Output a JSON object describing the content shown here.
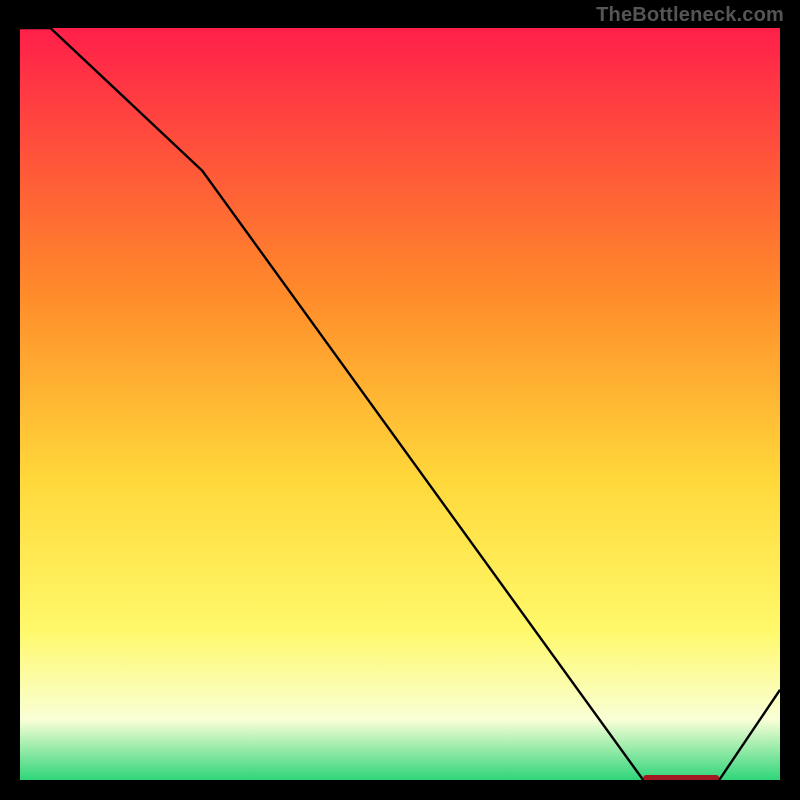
{
  "watermark": "TheBottleneck.com",
  "colors": {
    "top": "#ff1f4a",
    "mid_upper": "#ff8a2a",
    "mid": "#ffd83a",
    "mid_lower": "#fff96a",
    "pale": "#f9ffd6",
    "green": "#2fd57a",
    "line": "#000000",
    "marker": "#a11820",
    "frame": "#000000"
  },
  "chart_data": {
    "type": "line",
    "title": "",
    "xlabel": "",
    "ylabel": "",
    "xlim": [
      0,
      100
    ],
    "ylim": [
      0,
      100
    ],
    "x": [
      0,
      4,
      24,
      82,
      85,
      92,
      100
    ],
    "values": [
      100,
      100,
      81,
      0,
      0,
      0,
      12
    ],
    "marker_region": {
      "x0": 82,
      "x1": 92,
      "y": 0
    },
    "gradient_stops": [
      {
        "offset": 0.0,
        "color": "#ff1f4a"
      },
      {
        "offset": 0.35,
        "color": "#ff8a2a"
      },
      {
        "offset": 0.6,
        "color": "#ffd83a"
      },
      {
        "offset": 0.8,
        "color": "#fff96a"
      },
      {
        "offset": 0.92,
        "color": "#f9ffd6"
      },
      {
        "offset": 1.0,
        "color": "#2fd57a"
      }
    ]
  }
}
